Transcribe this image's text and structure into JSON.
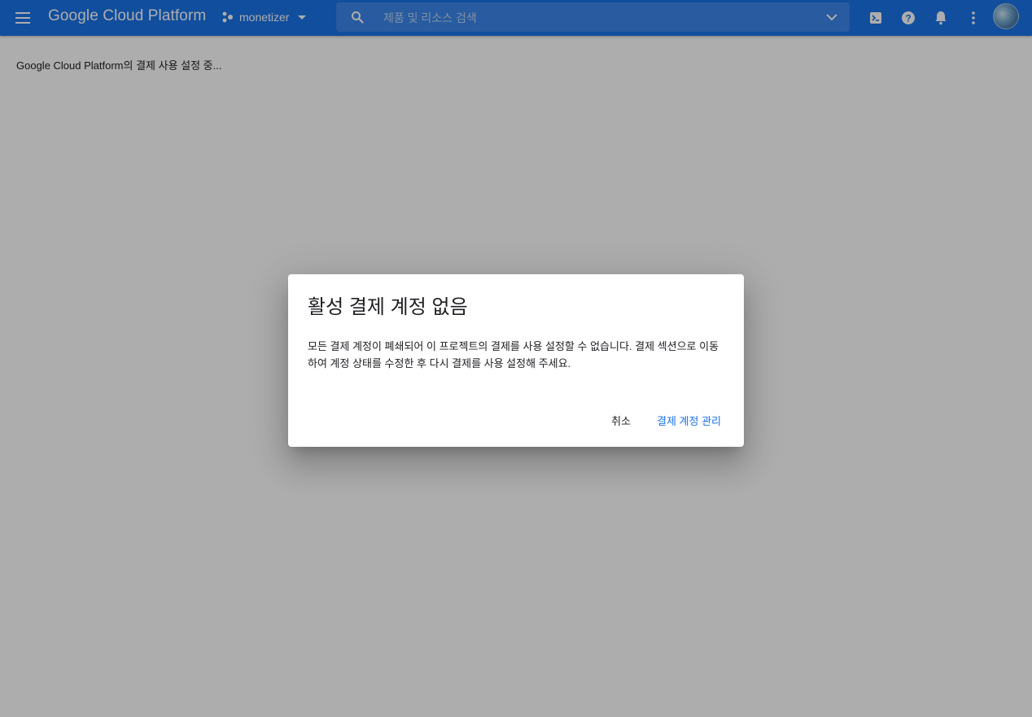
{
  "header": {
    "brand": "Google Cloud Platform",
    "project_name": "monetizer",
    "search_placeholder": "제품 및 리소스 검색"
  },
  "main": {
    "loading_text": "Google Cloud Platform의 결제 사용 설정 중..."
  },
  "dialog": {
    "title": "활성 결제 계정 없음",
    "body": "모든 결제 계정이 폐쇄되어 이 프로젝트의 결제를 사용 설정할 수 없습니다. 결제 섹션으로 이동하여 계정 상태를 수정한 후 다시 결제를 사용 설정해 주세요.",
    "cancel_label": "취소",
    "manage_label": "결제 계정 관리"
  },
  "colors": {
    "header_bg": "#1a73e8",
    "link": "#1a73e8",
    "scrim": "rgba(0,0,0,0.32)"
  },
  "icons": {
    "menu": "hamburger-icon",
    "project": "project-dots-icon",
    "search": "search-icon",
    "chevron": "chevron-down-icon",
    "terminal": "cloud-shell-icon",
    "help": "help-icon",
    "notifications": "bell-icon",
    "more": "more-vert-icon"
  }
}
